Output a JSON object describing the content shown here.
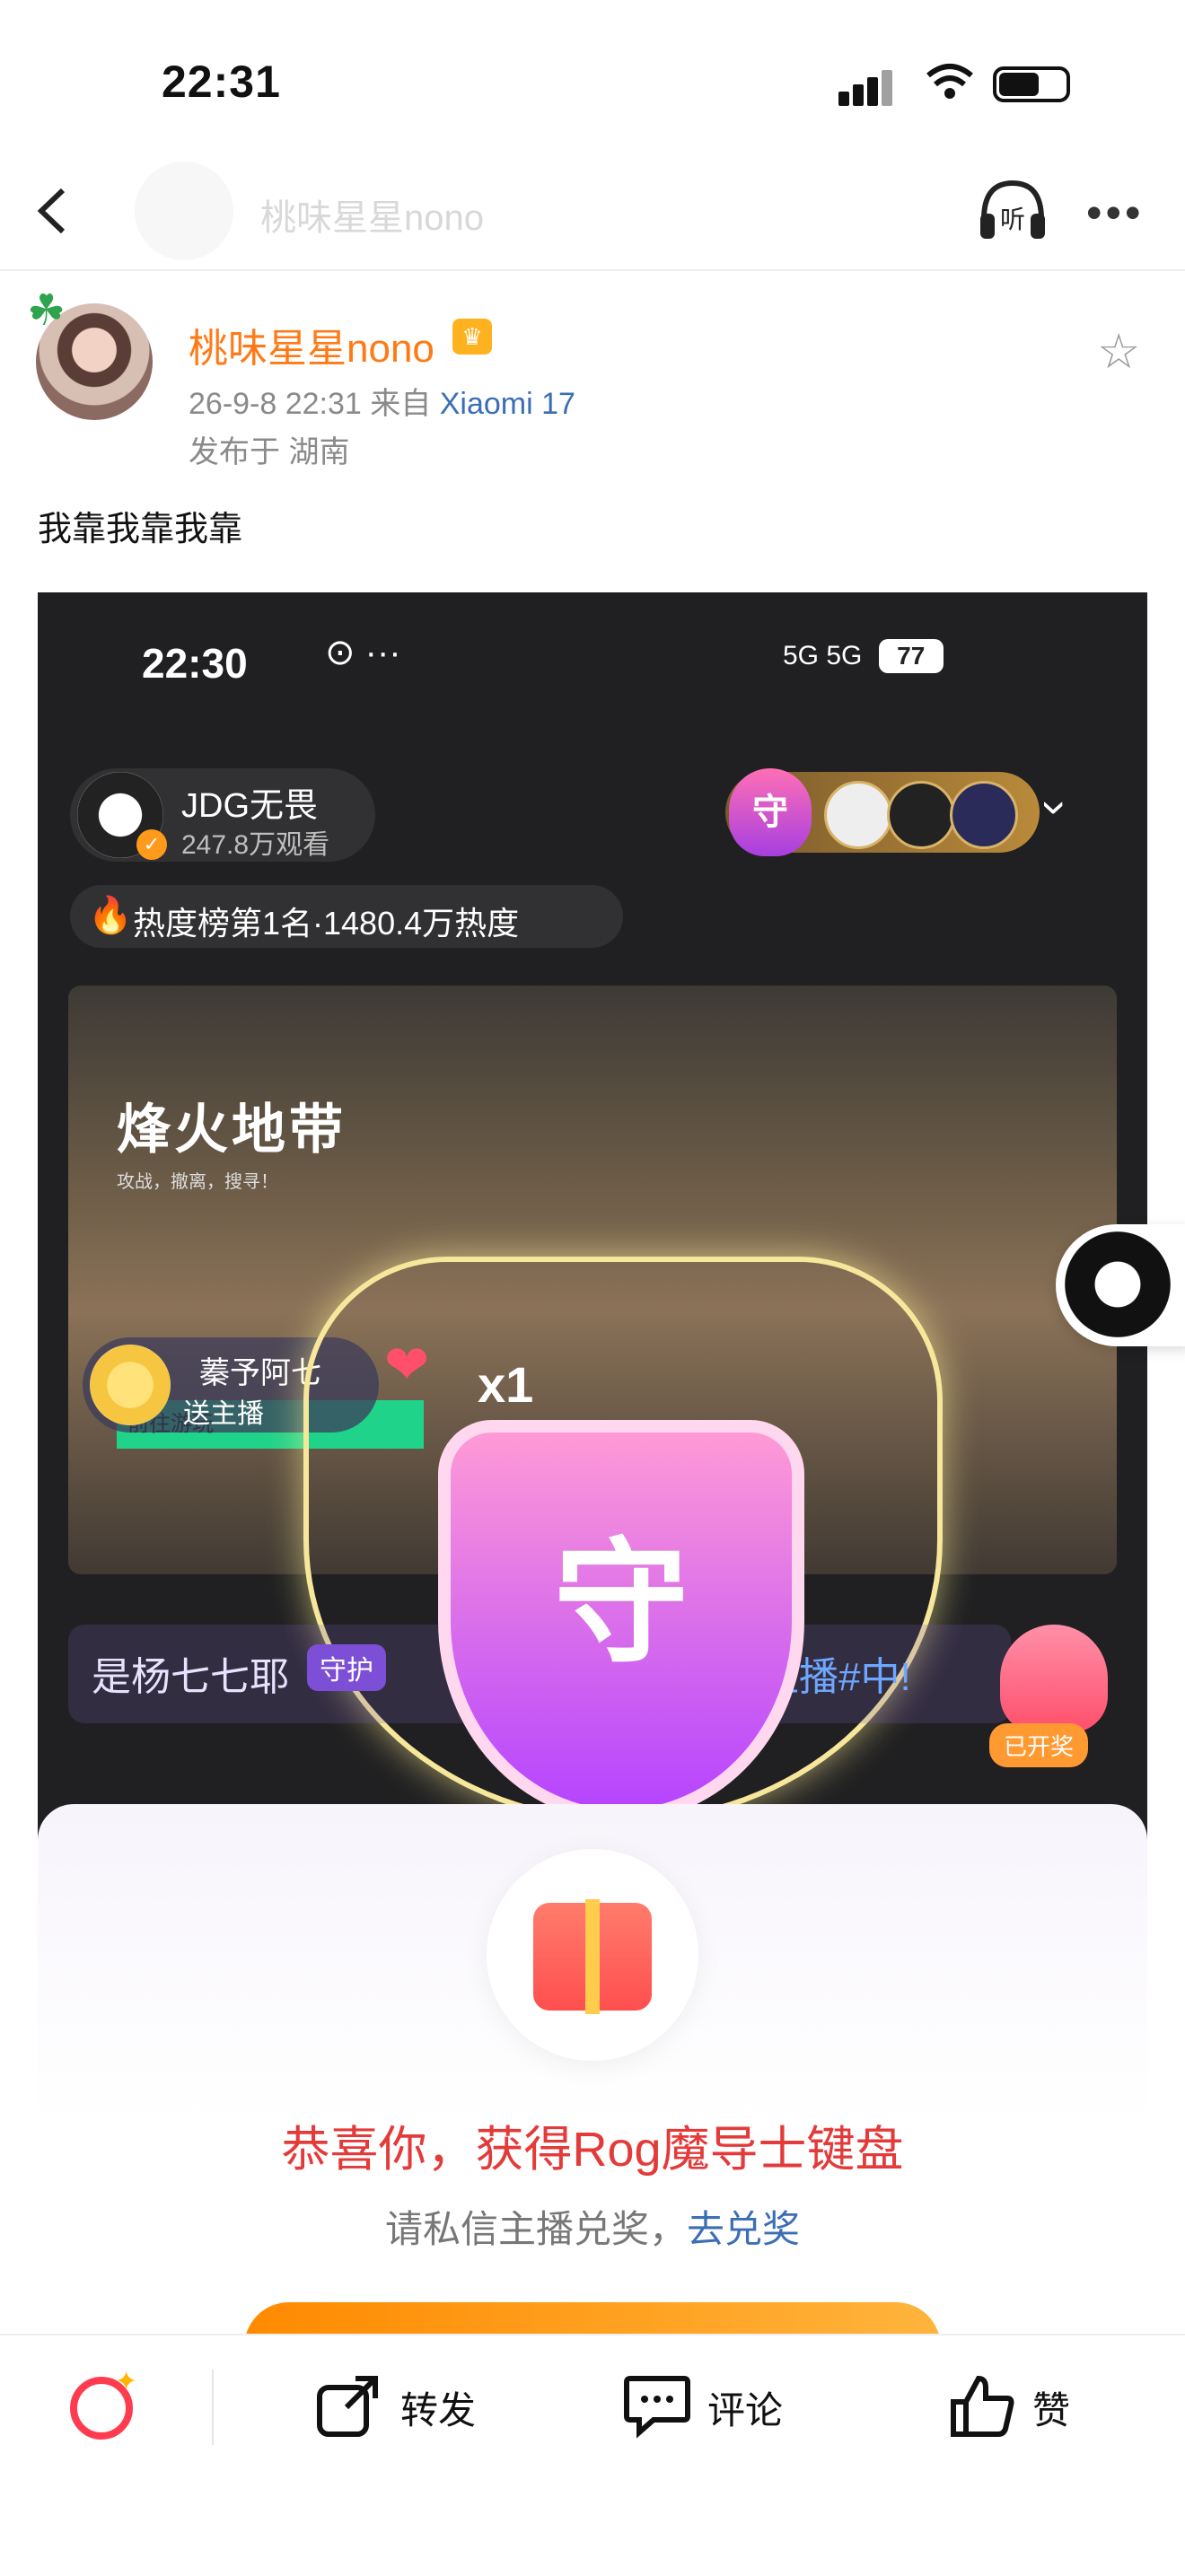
{
  "status_bar": {
    "time": "22:31"
  },
  "nav": {
    "title": "桃味星星nono"
  },
  "post": {
    "username": "桃味星星nono",
    "date": "26-9-8 22:31",
    "via_prefix": "来自",
    "source": "Xiaomi 17",
    "location": "发布于 湖南",
    "text": "我靠我靠我靠"
  },
  "screenshot": {
    "time": "22:30",
    "battery": "77",
    "network": "5G 5G",
    "streamer_name": "JDG无畏",
    "viewers": "247.8万观看",
    "guard_badge": "守",
    "hot_rank": "热度榜第1名·1480.4万热度",
    "video_title": "烽火地带",
    "video_subtitle": "攻战，撤离，搜寻！",
    "play_button": "前往游玩",
    "gift_sender": "蓁予阿七",
    "gift_action": "送主播",
    "gift_count": "x1",
    "chat_user": "是杨七七耶",
    "chat_guard": "守护",
    "chat_tail": "畏直播#中!",
    "bag_label": "已开奖",
    "shield_char": "守",
    "panel_title": "恭喜你，获得Rog魔导士键盘",
    "panel_hint": "请私信主播兑奖，",
    "panel_link": "去兑奖"
  },
  "bottom_bar": {
    "repost": "转发",
    "comment": "评论",
    "like": "赞"
  },
  "icons": {
    "back": "chevron-left-icon",
    "listen": "headphones-icon",
    "more": "more-icon",
    "star": "star-icon",
    "search": "search-icon",
    "repost": "share-icon",
    "comment": "comment-icon",
    "like": "thumbs-up-icon"
  },
  "colors": {
    "username": "#ff7a16",
    "link": "#3b6eb5",
    "congrats": "#e43a3a",
    "accent": "#ff3b4f"
  }
}
